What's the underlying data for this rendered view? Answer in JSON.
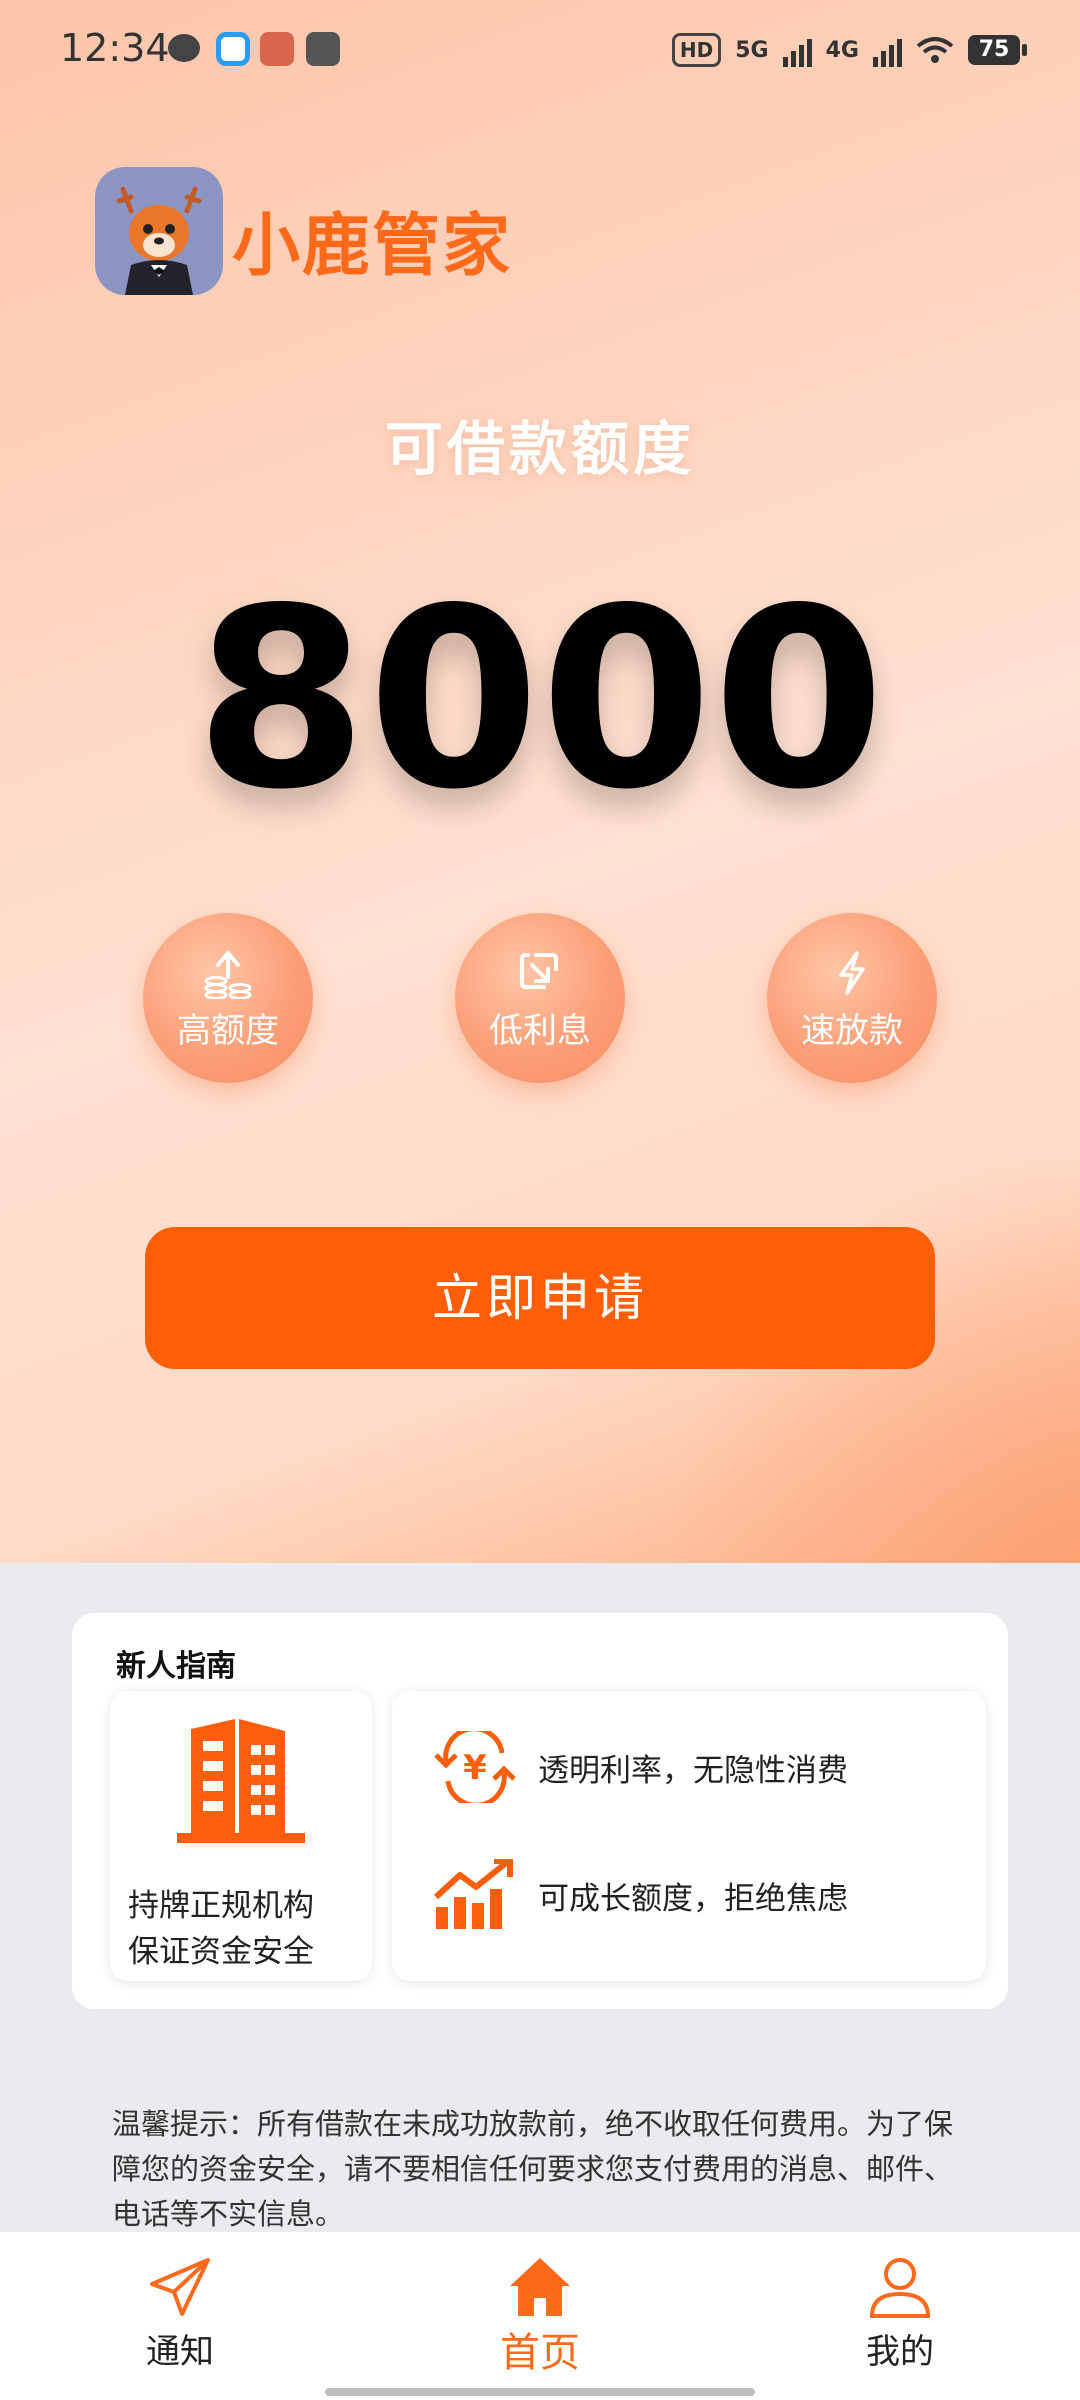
{
  "status_bar": {
    "time": "12:34",
    "hd": "HD",
    "net1": "5G",
    "net2": "4G",
    "battery": "75"
  },
  "brand": {
    "name": "小鹿管家"
  },
  "limit": {
    "label": "可借款额度",
    "amount": "8000"
  },
  "features": [
    {
      "label": "高额度",
      "icon": "coins-up-icon"
    },
    {
      "label": "低利息",
      "icon": "arrow-down-right-icon"
    },
    {
      "label": "速放款",
      "icon": "lightning-icon"
    }
  ],
  "apply_button": {
    "label": "立即申请"
  },
  "guide": {
    "title": "新人指南",
    "left_lines": [
      "持牌正规机构",
      "保证资金安全"
    ],
    "rows": [
      {
        "text": "透明利率，无隐性消费",
        "icon": "yen-cycle-icon"
      },
      {
        "text": "可成长额度，拒绝焦虑",
        "icon": "growth-chart-icon"
      }
    ]
  },
  "notice": "温馨提示：所有借款在未成功放款前，绝不收取任何费用。为了保障您的资金安全，请不要相信任何要求您支付费用的消息、邮件、电话等不实信息。",
  "nav": [
    {
      "label": "通知"
    },
    {
      "label": "首页"
    },
    {
      "label": "我的"
    }
  ],
  "colors": {
    "accent": "#fe5e08",
    "brand": "#ff6a1a",
    "feature": "#fb9f78"
  }
}
